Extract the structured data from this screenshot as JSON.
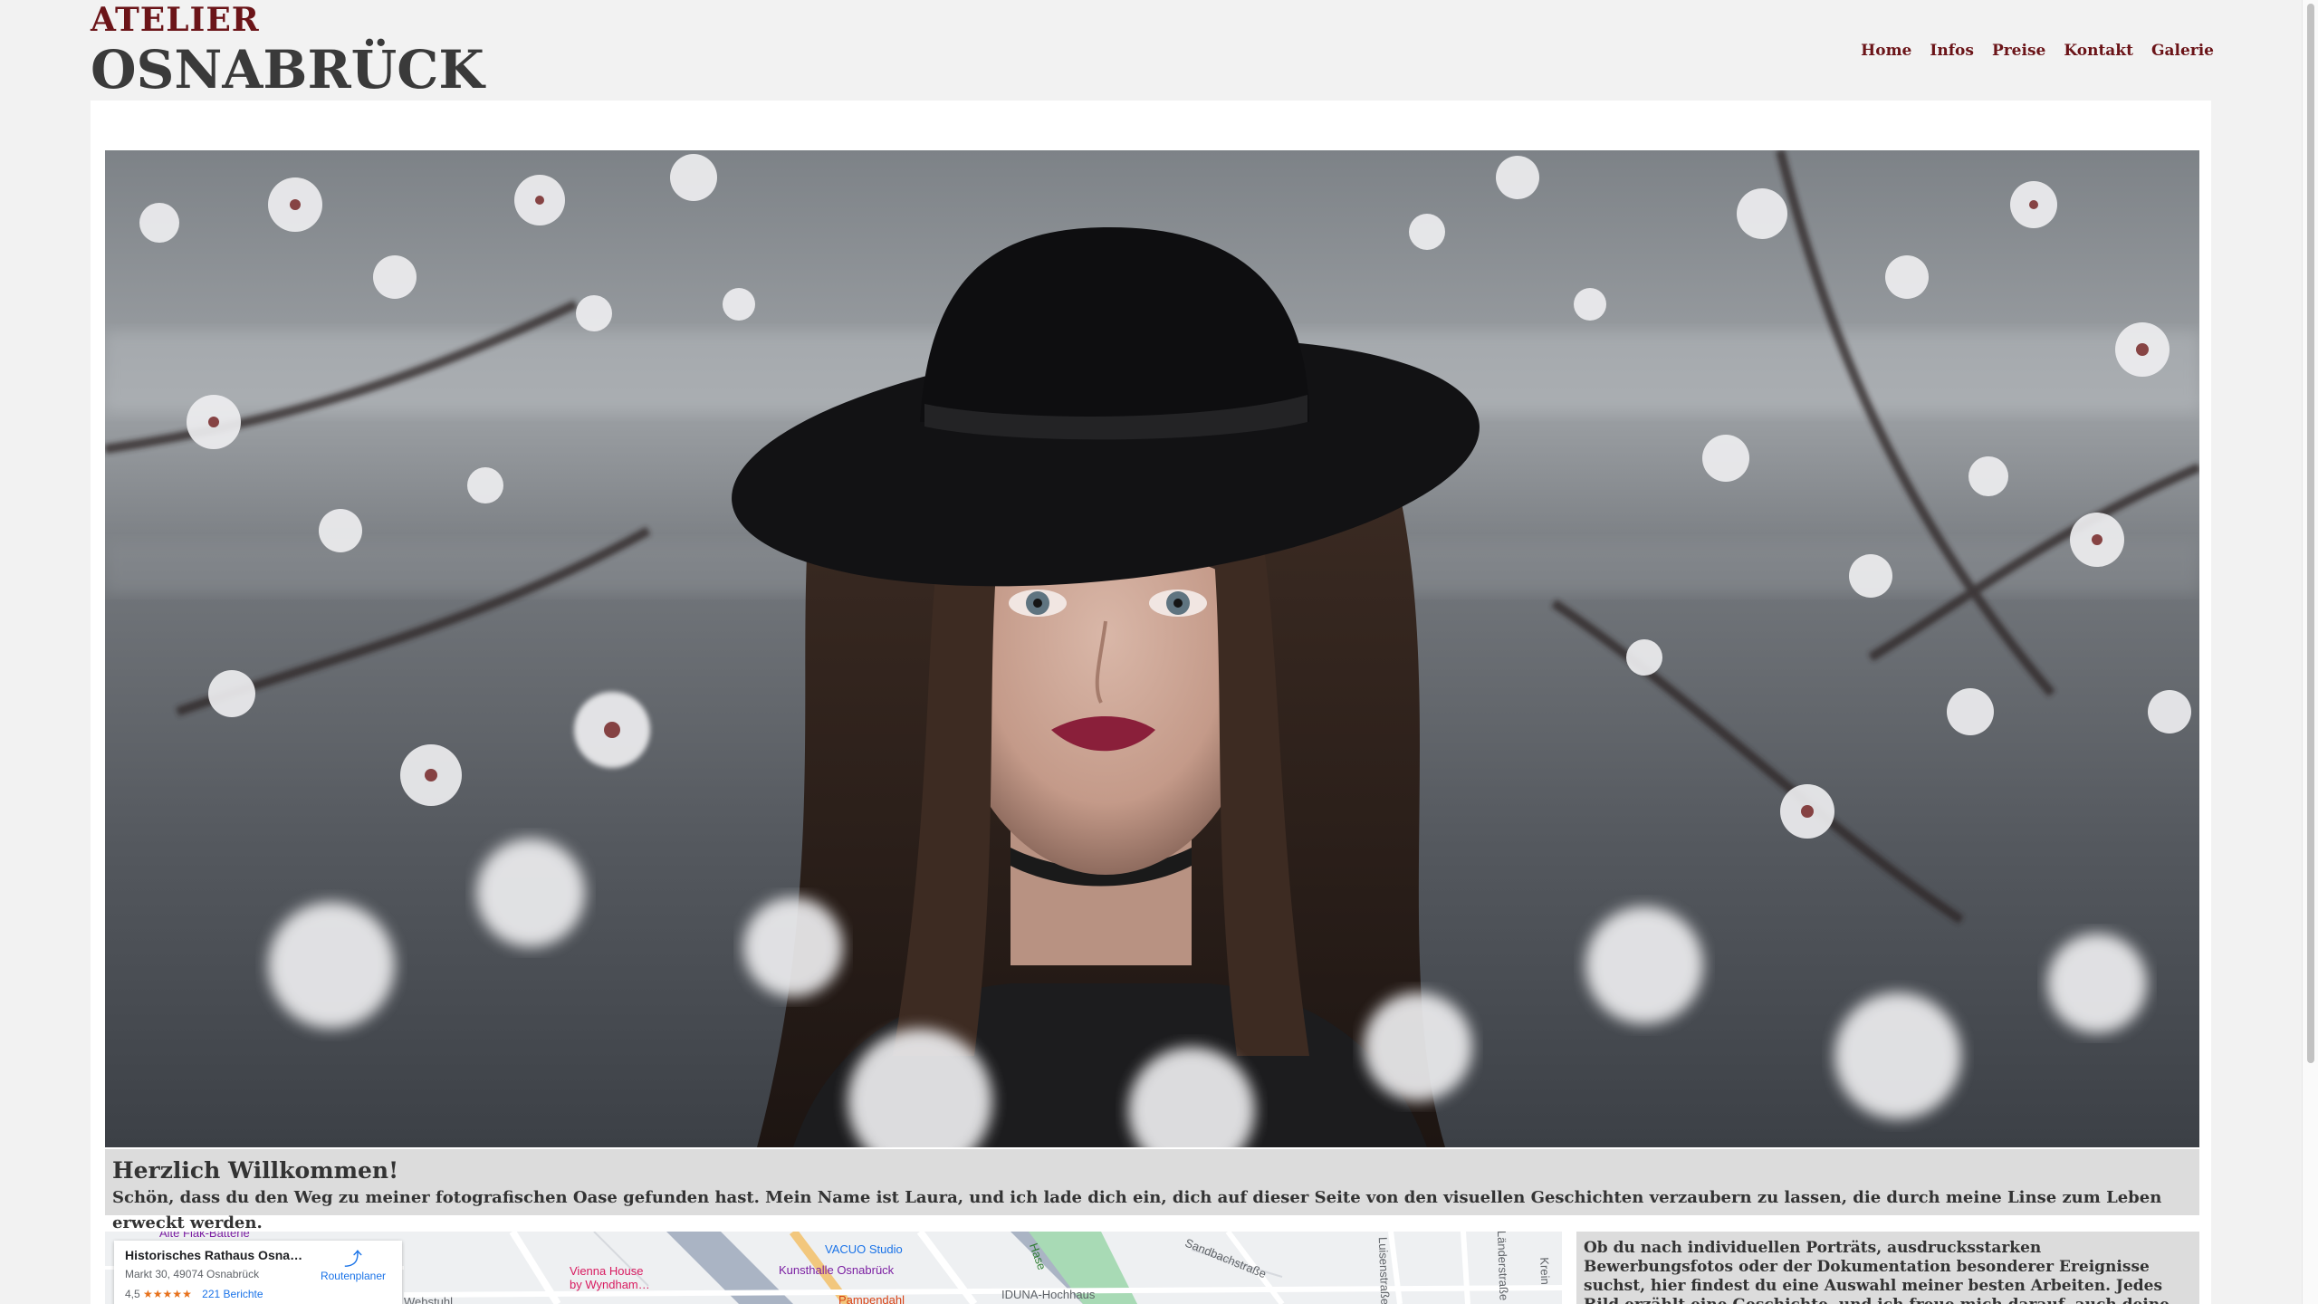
{
  "header": {
    "brand_top": "ATELIER",
    "brand_bottom": "OSNABRÜCK",
    "nav": [
      {
        "label": "Home"
      },
      {
        "label": "Infos"
      },
      {
        "label": "Preise"
      },
      {
        "label": "Kontakt"
      },
      {
        "label": "Galerie"
      }
    ]
  },
  "hero": {
    "image": "portrait-woman-black-hat-cherry-blossoms"
  },
  "welcome": {
    "title": "Herzlich Willkommen!",
    "text": "Schön, dass du den Weg zu meiner fotografischen Oase gefunden hast. Mein Name ist Laura, und ich lade dich ein, dich auf dieser Seite von den visuellen Geschichten verzaubern zu lassen, die durch meine Linse zum Leben erweckt werden."
  },
  "map": {
    "place_name": "Historisches Rathaus Osnabrü…",
    "address": "Markt 30, 49074 Osnabrück",
    "rating": "4,5",
    "stars": "★★★★★",
    "reviews": "221 Berichte",
    "route_label": "Routenplaner",
    "labels": {
      "flak": "Alte Flak-Batterie",
      "vienna": "Vienna House",
      "vienna2": "by Wyndham…",
      "vacuo": "VACUO Studio",
      "kunsthalle": "Kunsthalle Osnabrück",
      "iduna": "IDUNA-Hochhaus",
      "sandbach": "Sandbachstraße",
      "luisen": "Luisenstraße",
      "hase": "Hase",
      "webstuhl": "Webstuhl",
      "pamp": "Pampendahl",
      "lander": "Länderstraße",
      "krein": "Krein"
    },
    "accent": "#1a73e8"
  },
  "info": {
    "text": "Ob du nach individuellen Porträts, ausdrucksstarken Bewerbungsfotos oder der Dokumentation besonderer Ereignisse suchst, hier findest du eine Auswahl meiner besten Arbeiten. Jedes Bild erzählt eine Geschichte, und ich freue mich darauf, auch deine Geschichte in Bildern zu erzählen. Nimm dir Zeit, durch meine Galerien zu stöbern."
  },
  "colors": {
    "brand": "#6b1418",
    "heading": "#3a3a3a",
    "panel": "#dcdcdc"
  }
}
